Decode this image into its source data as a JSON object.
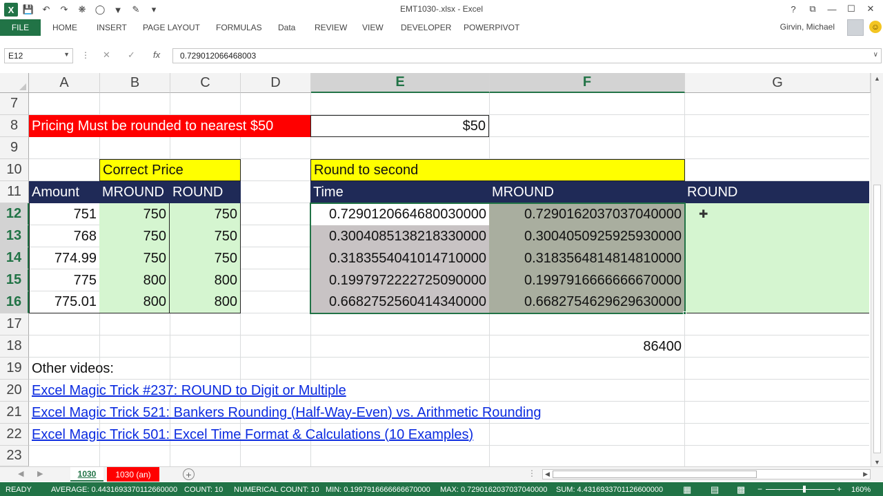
{
  "window": {
    "title": "EMT1030-.xlsx - Excel",
    "help": "?",
    "restore_ribbon": "⧉",
    "minimize": "—",
    "maximize": "☐",
    "close": "✕"
  },
  "qat": {
    "logo": "X",
    "icons": [
      "save-icon",
      "undo-icon",
      "redo-icon",
      "macro-icon",
      "shape-icon",
      "filter-icon",
      "format-painter-icon",
      "more-icon"
    ]
  },
  "ribbon": {
    "file": "FILE",
    "tabs": [
      "HOME",
      "INSERT",
      "PAGE LAYOUT",
      "FORMULAS",
      "Data",
      "REVIEW",
      "VIEW",
      "DEVELOPER",
      "POWERPIVOT"
    ],
    "user": "Girvin, Michael"
  },
  "formula_bar": {
    "name_box": "E12",
    "value": "0.729012066468003",
    "fx": "fx"
  },
  "columns": [
    "A",
    "B",
    "C",
    "D",
    "E",
    "F",
    "G"
  ],
  "rows": [
    "7",
    "8",
    "9",
    "10",
    "11",
    "12",
    "13",
    "14",
    "15",
    "16",
    "17",
    "18",
    "19",
    "20",
    "21",
    "22",
    "23"
  ],
  "cells": {
    "a8": "Pricing Must be rounded to nearest $50",
    "e8": "$50",
    "b10": "Correct Price",
    "e10": "Round to second",
    "a11": "Amount",
    "b11": "MROUND",
    "c11": "ROUND",
    "e11": "Time",
    "f11": "MROUND",
    "g11": "ROUND",
    "data_rows": [
      {
        "a": "751",
        "b": "750",
        "c": "750",
        "e": "0.7290120664680030000",
        "f": "0.7290162037037040000"
      },
      {
        "a": "768",
        "b": "750",
        "c": "750",
        "e": "0.3004085138218330000",
        "f": "0.3004050925925930000"
      },
      {
        "a": "774.99",
        "b": "750",
        "c": "750",
        "e": "0.3183554041014710000",
        "f": "0.3183564814814810000"
      },
      {
        "a": "775",
        "b": "800",
        "c": "800",
        "e": "0.1997972222725090000",
        "f": "0.1997916666666670000"
      },
      {
        "a": "775.01",
        "b": "800",
        "c": "800",
        "e": "0.6682752560414340000",
        "f": "0.6682754629629630000"
      }
    ],
    "f18": "86400",
    "a19": "Other videos:",
    "a20": "Excel Magic Trick #237: ROUND to Digit or Multiple ",
    "a21": "Excel Magic Trick 521: Bankers Rounding (Half-Way-Even) vs. Arithmetic Rounding ",
    "a22": "Excel Magic Trick 501: Excel Time Format & Calculations (10 Examples) "
  },
  "sheets": {
    "active": "1030",
    "other": "1030 (an)"
  },
  "status": {
    "mode": "READY",
    "average": "AVERAGE: 0.4431693370112660000",
    "count": "COUNT: 10",
    "numerical_count": "NUMERICAL COUNT: 10",
    "min": "MIN: 0.1997916666666670000",
    "max": "MAX: 0.7290162037037040000",
    "sum": "SUM: 4.4316933701126600000",
    "zoom": "160%"
  }
}
